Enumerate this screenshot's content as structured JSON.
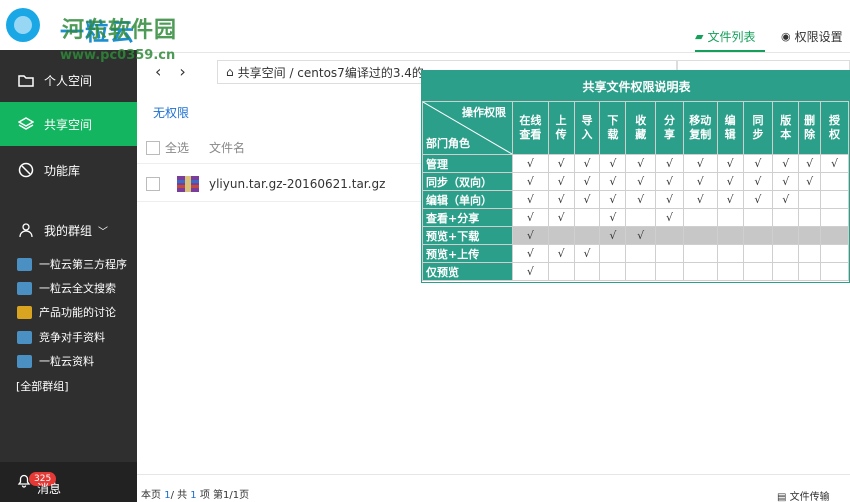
{
  "logo": {
    "text": "一粒云"
  },
  "watermark": {
    "name": "河东软件园",
    "url": "www.pc0359.cn"
  },
  "sidebar": {
    "items": [
      {
        "label": "个人空间",
        "icon": "folder-icon"
      },
      {
        "label": "共享空间",
        "icon": "layers-icon"
      },
      {
        "label": "功能库",
        "icon": "compass-icon"
      }
    ],
    "group_title": "我的群组",
    "groups": [
      {
        "label": "一粒云第三方程序",
        "color": "#4a90c2"
      },
      {
        "label": "一粒云全文搜索",
        "color": "#4a90c2"
      },
      {
        "label": "产品功能的讨论",
        "color": "#d9a520"
      },
      {
        "label": "竞争对手资料",
        "color": "#4a90c2"
      },
      {
        "label": "一粒云资料",
        "color": "#4a90c2"
      }
    ],
    "all_groups": "[全部群组]",
    "badge": "325",
    "message": "消息"
  },
  "tabs": {
    "file_list": "文件列表",
    "permission_settings": "权限设置"
  },
  "path": {
    "text": "共享空间 /  centos7编译过的3.4的"
  },
  "perm_label": "无权限",
  "list": {
    "select_all": "全选",
    "filename_header": "文件名",
    "files": [
      {
        "name": "yliyun.tar.gz-20160621.tar.gz"
      }
    ]
  },
  "footer": {
    "page_prefix": "本页 ",
    "page_count": "1",
    "page_mid": "/ 共 ",
    "total": "1",
    "page_suffix": " 项    第1/1页",
    "transfer": "文件传输"
  },
  "permission_table": {
    "title": "共享文件权限说明表",
    "header_right": "操作权限",
    "header_left": "部门角色",
    "columns": [
      "在线\n查看",
      "上\n传",
      "导\n入",
      "下\n载",
      "收\n藏",
      "分\n享",
      "移动\n复制",
      "编\n辑",
      "同\n步",
      "版\n本",
      "删\n除",
      "授\n权"
    ],
    "rows": [
      {
        "role": "管理",
        "cells": [
          "√",
          "√",
          "√",
          "√",
          "√",
          "√",
          "√",
          "√",
          "√",
          "√",
          "√",
          "√"
        ]
      },
      {
        "role": "同步（双向）",
        "cells": [
          "√",
          "√",
          "√",
          "√",
          "√",
          "√",
          "√",
          "√",
          "√",
          "√",
          "√",
          ""
        ]
      },
      {
        "role": "编辑（单向）",
        "cells": [
          "√",
          "√",
          "√",
          "√",
          "√",
          "√",
          "√",
          "√",
          "√",
          "√",
          "",
          ""
        ]
      },
      {
        "role": "查看+分享",
        "cells": [
          "√",
          "√",
          "",
          "√",
          "",
          "√",
          "",
          "",
          "",
          "",
          "",
          ""
        ]
      },
      {
        "role": "预览+下载",
        "cells": [
          "√",
          "",
          "",
          "√",
          "√",
          "",
          "",
          "",
          "",
          "",
          "",
          ""
        ]
      },
      {
        "role": "预览+上传",
        "cells": [
          "√",
          "√",
          "√",
          "",
          "",
          "",
          "",
          "",
          "",
          "",
          "",
          ""
        ]
      },
      {
        "role": "仅预览",
        "cells": [
          "√",
          "",
          "",
          "",
          "",
          "",
          "",
          "",
          "",
          "",
          "",
          ""
        ]
      }
    ],
    "highlight_row": 4
  }
}
